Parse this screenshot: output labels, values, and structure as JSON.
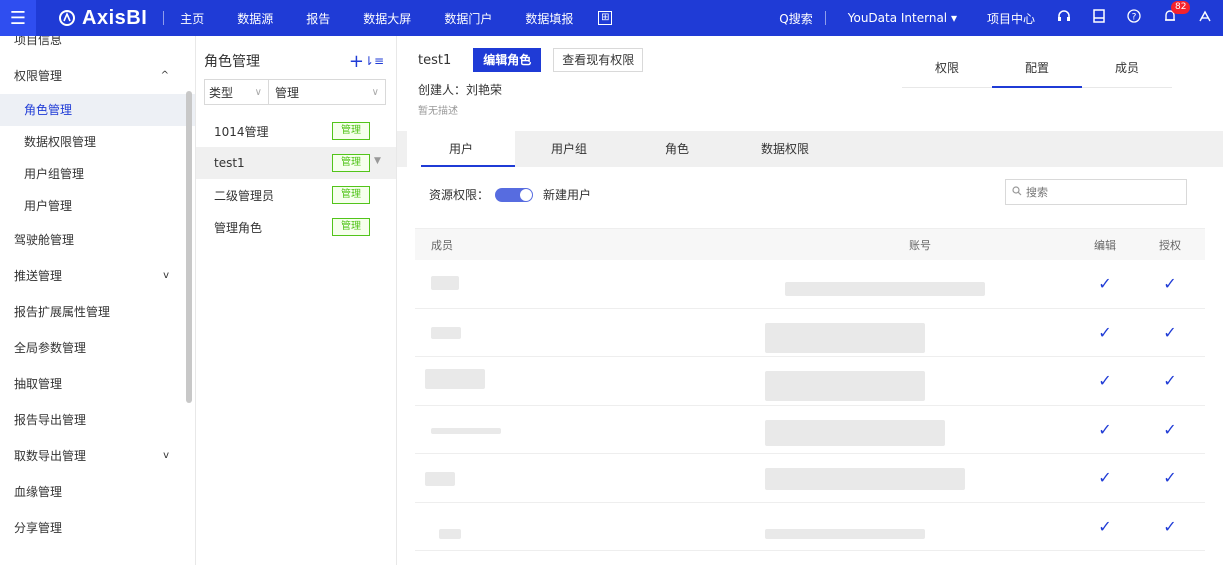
{
  "topbar": {
    "brand": "AxisBI",
    "nav": [
      "主页",
      "数据源",
      "报告",
      "数据大屏",
      "数据门户",
      "数据填报"
    ],
    "nav_icon": "⊞",
    "search_label": "Q搜索",
    "project": "YouData Internal ▾",
    "project_center": "项目中心",
    "notification_count": "82"
  },
  "sidebar": {
    "items": [
      {
        "label": "项目信息",
        "type": "top"
      },
      {
        "label": "权限管理",
        "type": "top",
        "arrow": "^"
      },
      {
        "label": "角色管理",
        "type": "sub",
        "active": true
      },
      {
        "label": "数据权限管理",
        "type": "sub"
      },
      {
        "label": "用户组管理",
        "type": "sub"
      },
      {
        "label": "用户管理",
        "type": "sub"
      },
      {
        "label": "驾驶舱管理",
        "type": "top"
      },
      {
        "label": "推送管理",
        "type": "top",
        "arrow": "v"
      },
      {
        "label": "报告扩展属性管理",
        "type": "top"
      },
      {
        "label": "全局参数管理",
        "type": "top"
      },
      {
        "label": "抽取管理",
        "type": "top"
      },
      {
        "label": "报告导出管理",
        "type": "top"
      },
      {
        "label": "取数导出管理",
        "type": "top",
        "arrow": "v"
      },
      {
        "label": "血缘管理",
        "type": "top"
      },
      {
        "label": "分享管理",
        "type": "top"
      }
    ]
  },
  "rolepanel": {
    "title": "角色管理",
    "add": "+",
    "sort": "⇂≡",
    "filter_type": "类型",
    "filter_value": "管理",
    "roles": [
      {
        "name": "1014管理",
        "tag": "管理"
      },
      {
        "name": "test1",
        "tag": "管理",
        "selected": true
      },
      {
        "name": "二级管理员",
        "tag": "管理"
      },
      {
        "name": "管理角色",
        "tag": "管理"
      }
    ]
  },
  "main": {
    "title": "test1",
    "edit_role": "编辑角色",
    "view_perm": "查看现有权限",
    "creator": "创建人：刘艳荣",
    "desc": "暂无描述",
    "top_tabs": [
      "权限",
      "配置",
      "成员"
    ],
    "active_top_tab": 1,
    "sub_tabs": [
      "用户",
      "用户组",
      "角色",
      "数据权限"
    ],
    "resource_perm_label": "资源权限：",
    "new_user_label": "新建用户",
    "search_placeholder": "搜索",
    "columns": {
      "member": "成员",
      "account": "账号",
      "edit": "编辑",
      "auth": "授权"
    },
    "check": "✓",
    "rows": [
      {
        "edit": true,
        "auth": true
      },
      {
        "edit": true,
        "auth": true
      },
      {
        "edit": true,
        "auth": true
      },
      {
        "edit": true,
        "auth": true
      },
      {
        "edit": true,
        "auth": true
      },
      {
        "edit": true,
        "auth": true
      }
    ]
  }
}
